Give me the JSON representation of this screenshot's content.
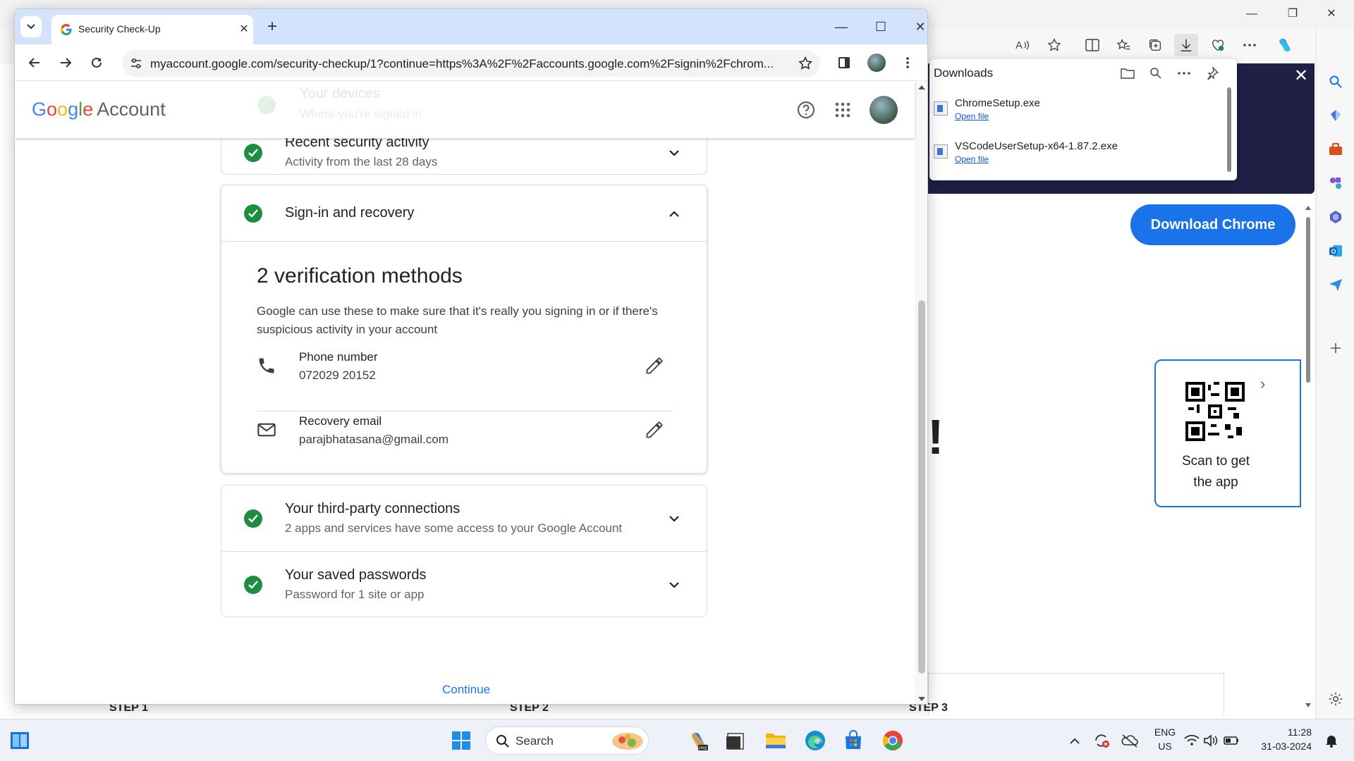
{
  "chrome_window": {
    "tab_title": "Security Check-Up",
    "url": "myaccount.google.com/security-checkup/1?continue=https%3A%2F%2Faccounts.google.com%2Fsignin%2Fchrom..."
  },
  "google_account": {
    "logo_letters": [
      "G",
      "o",
      "o",
      "g",
      "l",
      "e"
    ],
    "logo_suffix": "Account",
    "ghost_row": {
      "title": "Your devices",
      "subtitle": "Where you're signed in"
    },
    "rows": {
      "recent_activity": {
        "title": "Recent security activity",
        "subtitle": "Activity from the last 28 days"
      },
      "signin_recovery": {
        "title": "Sign-in and recovery"
      },
      "third_party": {
        "title": "Your third-party connections",
        "subtitle": "2 apps and services have some access to your Google Account"
      },
      "passwords": {
        "title": "Your saved passwords",
        "subtitle": "Password for 1 site or app"
      }
    },
    "verification": {
      "title": "2 verification methods",
      "description": "Google can use these to make sure that it's really you signing in or if there's suspicious activity in your account",
      "phone": {
        "label": "Phone number",
        "value": "072029 20152"
      },
      "email": {
        "label": "Recovery email",
        "value": "parajbhatasana@gmail.com"
      }
    },
    "continue_label": "Continue"
  },
  "edge": {
    "downloads": {
      "title": "Downloads",
      "items": [
        {
          "name": "ChromeSetup.exe",
          "action": "Open file"
        },
        {
          "name": "VSCodeUserSetup-x64-1.87.2.exe",
          "action": "Open file"
        }
      ]
    },
    "download_chrome_label": "Download Chrome",
    "qr_text_line1": "Scan to get",
    "qr_text_line2": "the app",
    "exclaim": "!",
    "steps": [
      "STEP 1",
      "STEP 2",
      "STEP 3"
    ]
  },
  "taskbar": {
    "search_label": "Search",
    "lang_line1": "ENG",
    "lang_line2": "US",
    "time": "11:28",
    "date": "31-03-2024"
  },
  "colors": {
    "google_blue": "#1a73e8",
    "check_green": "#1e8e3e",
    "tabstrip": "#d3e3fd",
    "edge_banner": "#202046"
  }
}
